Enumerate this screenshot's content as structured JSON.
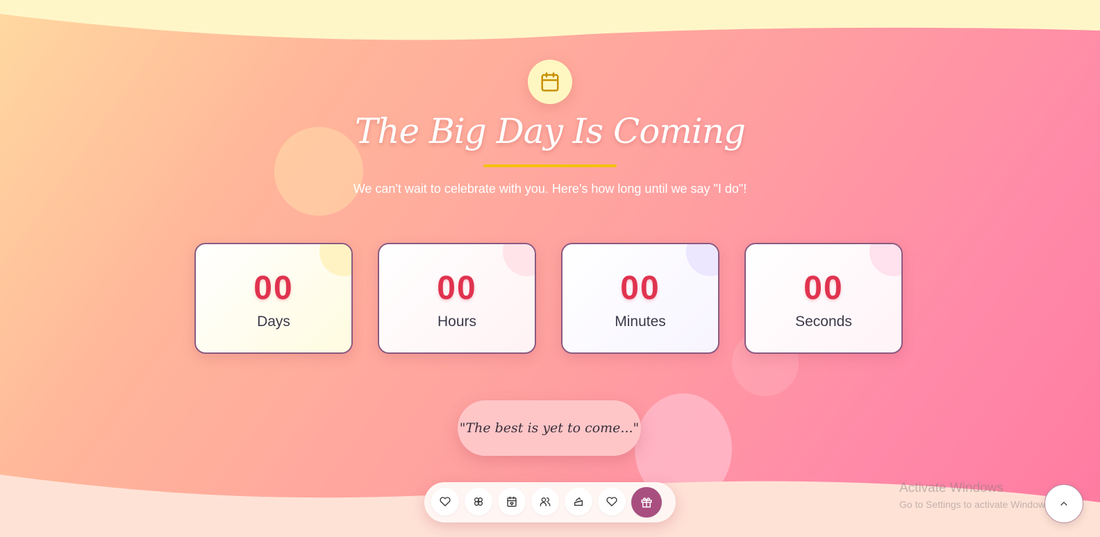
{
  "header": {
    "icon": "calendar-icon",
    "title": "The Big Day Is Coming",
    "subtitle": "We can't wait to celebrate with you. Here's how long until we say \"I do\"!"
  },
  "countdown": [
    {
      "value": "00",
      "label": "Days"
    },
    {
      "value": "00",
      "label": "Hours"
    },
    {
      "value": "00",
      "label": "Minutes"
    },
    {
      "value": "00",
      "label": "Seconds"
    }
  ],
  "quote": "\"The best is yet to come...\"",
  "nav": {
    "items": [
      {
        "icon": "heart-icon",
        "active": false
      },
      {
        "icon": "flower-icon",
        "active": false
      },
      {
        "icon": "calendar-heart-icon",
        "active": false
      },
      {
        "icon": "users-icon",
        "active": false
      },
      {
        "icon": "cake-icon",
        "active": false
      },
      {
        "icon": "heart-icon",
        "active": false
      },
      {
        "icon": "gift-icon",
        "active": true
      }
    ]
  },
  "watermark": {
    "line1": "Activate Windows",
    "line2": "Go to Settings to activate Windows."
  },
  "scroll_top": {
    "icon": "chevron-up-icon"
  },
  "colors": {
    "accent": "#e0334f",
    "nav_active": "#a84f80",
    "underline": "#f4c20d",
    "icon_gold": "#c99000"
  }
}
